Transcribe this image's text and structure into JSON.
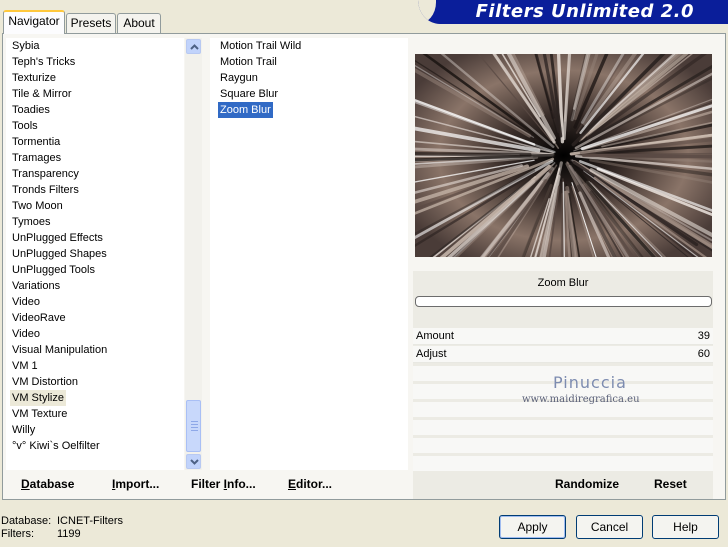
{
  "tabs": [
    "Navigator",
    "Presets",
    "About"
  ],
  "banner_title": "Filters Unlimited 2.0",
  "categories": [
    "Sybia",
    "Teph's Tricks",
    "Texturize",
    "Tile & Mirror",
    "Toadies",
    "Tools",
    "Tormentia",
    "Tramages",
    "Transparency",
    "Tronds Filters",
    "Two Moon",
    "Tymoes",
    "UnPlugged Effects",
    "UnPlugged Shapes",
    "UnPlugged Tools",
    "Variations",
    "Video",
    "VideoRave",
    "Video",
    "Visual Manipulation",
    "VM 1",
    "VM Distortion",
    "VM Stylize",
    "VM Texture",
    "Willy",
    "°v° Kiwi`s Oelfilter"
  ],
  "selected_category": "VM Stylize",
  "filters": [
    "Motion Trail Wild",
    "Motion Trail",
    "Raygun",
    "Square Blur",
    "Zoom Blur"
  ],
  "selected_filter": "Zoom Blur",
  "filter_name": "Zoom Blur",
  "params": [
    {
      "label": "Amount",
      "value": "39"
    },
    {
      "label": "Adjust",
      "value": "60"
    }
  ],
  "watermark": {
    "name": "Pinuccia",
    "url": "www.maidiregrafica.eu"
  },
  "panel_buttons": {
    "database": {
      "accel": "D",
      "rest": "atabase"
    },
    "import": {
      "accel": "I",
      "rest": "mport..."
    },
    "filter_info": {
      "pre": "Filter ",
      "accel": "I",
      "rest": "nfo..."
    },
    "editor": {
      "accel": "E",
      "rest": "ditor..."
    },
    "randomize": "Randomize",
    "reset": "Reset"
  },
  "status": {
    "database_label": "Database:",
    "database_value": "ICNET-Filters",
    "filters_label": "Filters:",
    "filters_value": "1199"
  },
  "dialog_buttons": {
    "apply": "Apply",
    "cancel": "Cancel",
    "help": "Help"
  },
  "colors": {
    "banner": "#0a1e9a",
    "selection": "#316ac5",
    "tab_highlight": "#ffc83c"
  }
}
